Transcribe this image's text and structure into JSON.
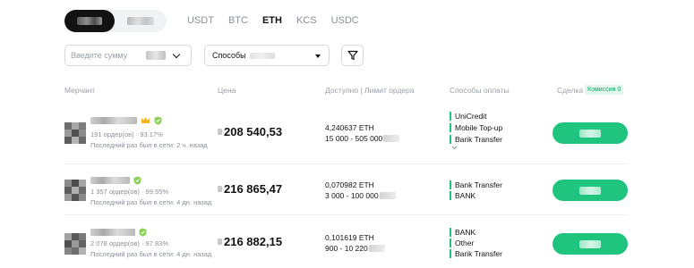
{
  "coins": [
    "USDT",
    "BTC",
    "ETH",
    "KCS",
    "USDC"
  ],
  "active_coin": "ETH",
  "filters": {
    "amount_placeholder": "Введите сумму",
    "methods_label": "Способы"
  },
  "headers": {
    "merchant": "Мерчант",
    "price": "Цена",
    "available": "Доступно | Лимит ордера",
    "payment": "Способы оплаты",
    "trade": "Сделка",
    "commission": "Комиссия 0"
  },
  "colors": {
    "accent": "#1fc47f",
    "text": "#121212",
    "muted": "#8a8f98"
  },
  "offers": [
    {
      "stats": "191 ордер(ов) · 93.17%",
      "last_seen": "Последний раз был в сети: 2 ч. назад",
      "price": "208 540,53",
      "available": "4,240637 ETH",
      "limit": "15 000 - 505 000",
      "methods": [
        "UniCredit",
        "Mobile Top-up",
        "Bank Transfer"
      ],
      "more_icon": "chevron-down"
    },
    {
      "stats": "1 357 ордер(ов) · 99.55%",
      "last_seen": "Последний раз был в сети: 4 дн. назад",
      "price": "216 865,47",
      "available": "0,070982 ETH",
      "limit": "3 000 - 100 000",
      "methods": [
        "Bank Transfer",
        "BANK"
      ]
    },
    {
      "stats": "2 078 ордер(ов) · 97.83%",
      "last_seen": "Последний раз был в сети: 4 дн. назад",
      "price": "216 882,15",
      "available": "0,101619 ETH",
      "limit": "900 - 10 220",
      "methods": [
        "BANK",
        "Other",
        "Bank Transfer"
      ]
    }
  ]
}
